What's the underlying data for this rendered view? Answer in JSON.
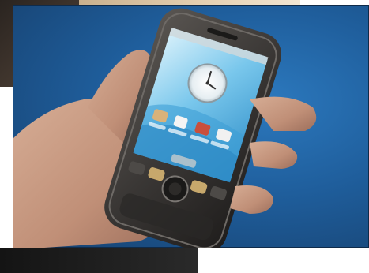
{
  "scene": {
    "subject": "hand-holding-smartphone",
    "colors": {
      "background_blue": "#1f5e9c",
      "phone_body": "#3a3735",
      "screen_sky": "#5fb8e6",
      "skin": "#c79b84"
    },
    "icons": [
      "clock-widget-icon",
      "app-icon",
      "app-icon",
      "app-icon",
      "app-icon"
    ]
  }
}
